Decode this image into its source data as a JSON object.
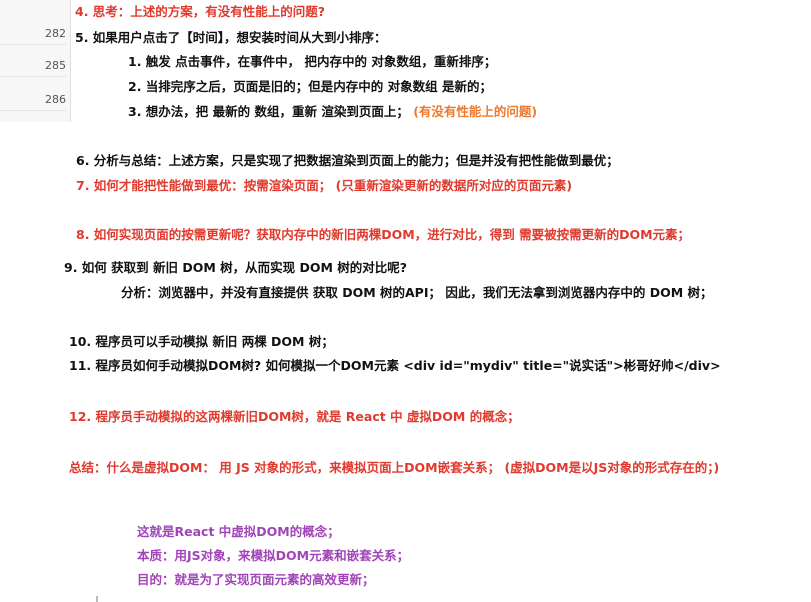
{
  "line_numbers": [
    "282",
    "285",
    "286"
  ],
  "lines": [
    {
      "id": "l4",
      "text": "4. 思考：上述的方案，有没有性能上的问题?"
    },
    {
      "id": "l5",
      "text": "5. 如果用户点击了【时间】，想安装时间从大到小排序："
    },
    {
      "id": "l5_1",
      "text": "1. 触发 点击事件，在事件中， 把内存中的 对象数组，重新排序；"
    },
    {
      "id": "l5_2",
      "text": "2. 当排完序之后，页面是旧的；但是内存中的 对象数组 是新的；"
    },
    {
      "id": "l5_3",
      "text": "3. 想办法，把 最新的 数组，重新 渲染到页面上；",
      "highlight": "(有没有性能上的问题)"
    },
    {
      "id": "l6",
      "text": "6. 分析与总结：上述方案，只是实现了把数据渲染到页面上的能力；但是并没有把性能做到最优；"
    },
    {
      "id": "l7",
      "text": "7. 如何才能把性能做到最优：按需渲染页面；  (只重新渲染更新的数据所对应的页面元素)"
    },
    {
      "id": "l8",
      "text": "8. 如何实现页面的按需更新呢？获取内存中的新旧两棵DOM，进行对比，得到 需要被按需更新的DOM元素；"
    },
    {
      "id": "l9",
      "text": "9. 如何 获取到 新旧 DOM 树，从而实现 DOM 树的对比呢?"
    },
    {
      "id": "l9_a",
      "text": "分析：浏览器中，并没有直接提供 获取 DOM 树的API；  因此，我们无法拿到浏览器内存中的 DOM 树；"
    },
    {
      "id": "l10",
      "text": "10. 程序员可以手动模拟 新旧 两棵 DOM 树；"
    },
    {
      "id": "l11",
      "text": "11. 程序员如何手动模拟DOM树?  如何模拟一个DOM元素 <div id=\"mydiv\" title=\"说实话\">彬哥好帅</div>"
    },
    {
      "id": "l12",
      "text": "12. 程序员手动模拟的这两棵新旧DOM树，就是 React 中 虚拟DOM 的概念；"
    },
    {
      "id": "summary",
      "text": "总结：什么是虚拟DOM：  用 JS 对象的形式，来模拟页面上DOM嵌套关系；  (虚拟DOM是以JS对象的形式存在的；)"
    },
    {
      "id": "p1",
      "text": "这就是React 中虚拟DOM的概念；"
    },
    {
      "id": "p2",
      "text": "本质：用JS对象，来模拟DOM元素和嵌套关系；"
    },
    {
      "id": "p3",
      "text": "目的：就是为了实现页面元素的高效更新；"
    }
  ],
  "colors": {
    "black": "#111111",
    "red": "#e03a2e",
    "orange": "#f0782a",
    "purple": "#a044b8"
  }
}
